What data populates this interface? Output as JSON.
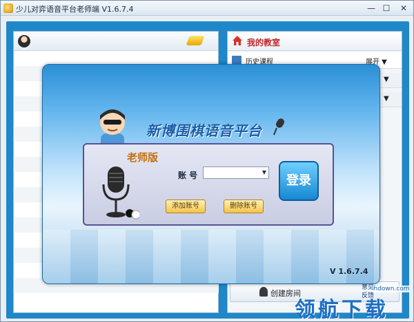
{
  "window": {
    "title": "少儿对弈语音平台老师端 V1.6.7.4",
    "min": "—",
    "max": "☐",
    "close": "✕"
  },
  "right_panel": {
    "title": "我的教室",
    "items": [
      {
        "label": "历史课程",
        "action": "展开 ▼"
      }
    ],
    "collapsed_chevrons": [
      "▼",
      "▼"
    ]
  },
  "bottom_bar": {
    "create_label": "创建房间",
    "feedback": "意见\n反馈"
  },
  "login": {
    "platform_title": "新博围棋语音平台",
    "edition": "老师版",
    "account_label": "账 号",
    "account_value": "",
    "account_arrow": "▼",
    "add_account": "添加账号",
    "delete_account": "删除账号",
    "login": "登录",
    "version": "V 1.6.7.4"
  },
  "watermark": {
    "url": "lhdown.com",
    "text": "领航下载"
  }
}
